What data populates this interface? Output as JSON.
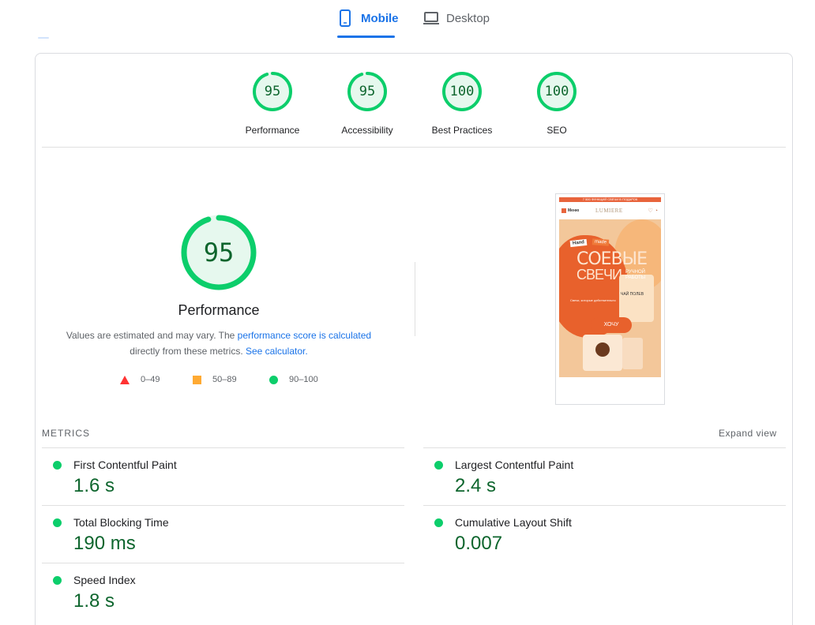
{
  "tabs": {
    "mobile": "Mobile",
    "desktop": "Desktop",
    "active": "mobile"
  },
  "summary": [
    {
      "score": "95",
      "label": "Performance",
      "fraction": 0.95
    },
    {
      "score": "95",
      "label": "Accessibility",
      "fraction": 0.95
    },
    {
      "score": "100",
      "label": "Best Practices",
      "fraction": 1.0
    },
    {
      "score": "100",
      "label": "SEO",
      "fraction": 1.0
    }
  ],
  "performance": {
    "score": "95",
    "fraction": 0.95,
    "title": "Performance",
    "note_prefix": "Values are estimated and may vary. The ",
    "note_link1": "performance score is calculated",
    "note_middle": "directly from these metrics. ",
    "note_link2": "See calculator."
  },
  "legend": {
    "fail": "0–49",
    "average": "50–89",
    "pass": "90–100"
  },
  "thumbnail": {
    "topbar": "7 500 ФУНКЦИЙ СВЕЧИ В ПОДАРОК",
    "menu": "Меню",
    "logo": "LUMIERE",
    "hand": "Hand",
    "made": "made",
    "title1": "СОЕВЫЕ",
    "title2": "СВЕЧИ",
    "subtitle": "РУЧНОЙ РАБОТЫ",
    "small": "Свечи, которые действительно",
    "jar_label": "ЧАЙ ПОЛЕВ",
    "button": "ХОЧУ"
  },
  "metrics": {
    "heading": "METRICS",
    "expand": "Expand view",
    "items": [
      {
        "label": "First Contentful Paint",
        "value": "1.6 s"
      },
      {
        "label": "Largest Contentful Paint",
        "value": "2.4 s"
      },
      {
        "label": "Total Blocking Time",
        "value": "190 ms"
      },
      {
        "label": "Cumulative Layout Shift",
        "value": "0.007"
      },
      {
        "label": "Speed Index",
        "value": "1.8 s"
      }
    ]
  },
  "colors": {
    "pass": "#0cce6b",
    "pass_text": "#0d652d",
    "pass_bg": "#e6f8ee",
    "average": "#ffaa33",
    "fail": "#ff3333",
    "accent": "#1a73e8"
  }
}
